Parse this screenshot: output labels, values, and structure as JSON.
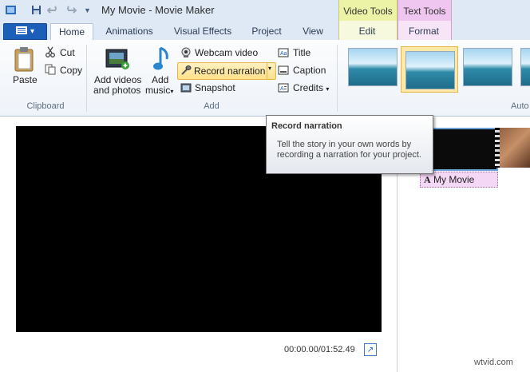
{
  "window": {
    "title": "My Movie - Movie Maker"
  },
  "context_tabs": {
    "video_tools": "Video Tools",
    "text_tools": "Text Tools"
  },
  "tabs": {
    "home": "Home",
    "animations": "Animations",
    "visual_effects": "Visual Effects",
    "project": "Project",
    "view": "View",
    "edit": "Edit",
    "format": "Format"
  },
  "ribbon": {
    "clipboard": {
      "paste": "Paste",
      "cut": "Cut",
      "copy": "Copy",
      "group_label": "Clipboard"
    },
    "add": {
      "add_videos_line1": "Add videos",
      "add_videos_line2": "and photos",
      "add_music_line1": "Add",
      "add_music_line2": "music",
      "webcam_video": "Webcam video",
      "record_narration": "Record narration",
      "snapshot": "Snapshot",
      "title": "Title",
      "caption": "Caption",
      "credits": "Credits",
      "group_label": "Add"
    },
    "auto_group_label": "Auto"
  },
  "tooltip": {
    "title": "Record narration",
    "body": "Tell the story in your own words by recording a narration for your project."
  },
  "preview": {
    "timecode": "00:00.00/01:52.49"
  },
  "storyboard": {
    "caption_text": "My Movie",
    "caption_icon": "A"
  },
  "watermark": "wtvid.com",
  "icons": {
    "menu": "menu-icon",
    "save": "save-icon",
    "undo": "undo-icon",
    "redo": "redo-icon"
  },
  "colors": {
    "accent": "#1c5fb8",
    "video_tools": "#ecf3a6",
    "text_tools": "#efc6ef",
    "highlight": "#ffe08a"
  }
}
